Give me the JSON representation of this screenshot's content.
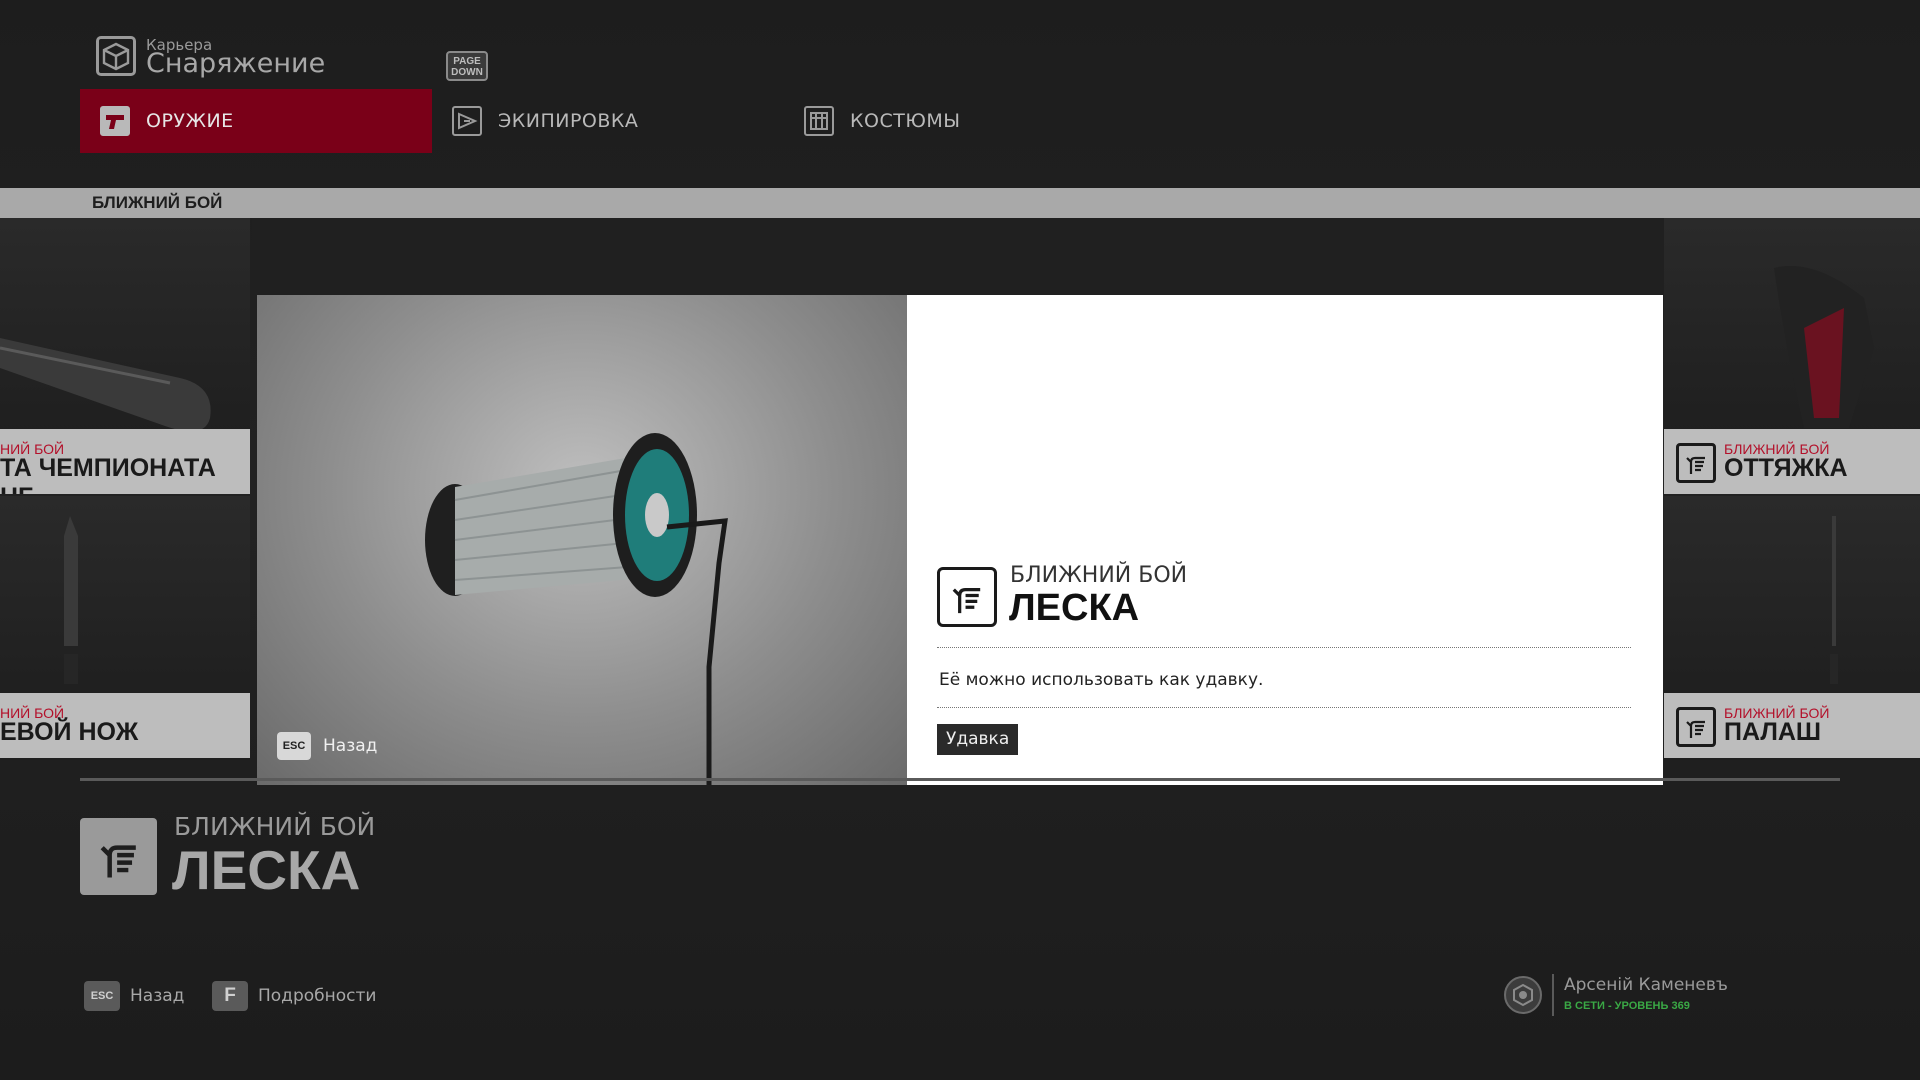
{
  "header": {
    "subtitle": "Карьера",
    "title": "Снаряжение",
    "page_key": "PAGE DOWN",
    "box_icon": "box-icon"
  },
  "tabs": [
    {
      "label": "ОРУЖИЕ",
      "icon": "pistol-icon",
      "active": true
    },
    {
      "label": "ЭКИПИРОВКА",
      "icon": "gear-icon",
      "active": false
    },
    {
      "label": "КОСТЮМЫ",
      "icon": "suit-icon",
      "active": false
    }
  ],
  "category_bar": "БЛИЖНИЙ БОЙ",
  "grid": {
    "left_top": {
      "category": "НИЙ БОЙ",
      "name": "ТА ЧЕМПИОНАТА HF"
    },
    "left_bottom": {
      "category": "НИЙ БОЙ",
      "name": "ЕВОЙ НОЖ"
    },
    "right_top": {
      "category": "БЛИЖНИЙ БОЙ",
      "name": "ОТТЯЖКА"
    },
    "right_bottom": {
      "category": "БЛИЖНИЙ БОЙ",
      "name": "ПАЛАШ"
    }
  },
  "modal": {
    "category": "БЛИЖНИЙ БОЙ",
    "name": "ЛЕСКА",
    "description": "Её можно использовать как удавку.",
    "tag": "Удавка",
    "back_key": "ESC",
    "back_label": "Назад"
  },
  "detail": {
    "category": "БЛИЖНИЙ БОЙ",
    "name": "ЛЕСКА"
  },
  "footer": {
    "back_key": "ESC",
    "back_label": "Назад",
    "details_key": "F",
    "details_label": "Подробности"
  },
  "profile": {
    "name": "Арсеній Каменевъ",
    "status": "В СЕТИ - УРОВЕНЬ 369"
  },
  "colors": {
    "accent_red": "#7a0018",
    "category_red": "#b3102a",
    "online_green": "#3aa845"
  }
}
